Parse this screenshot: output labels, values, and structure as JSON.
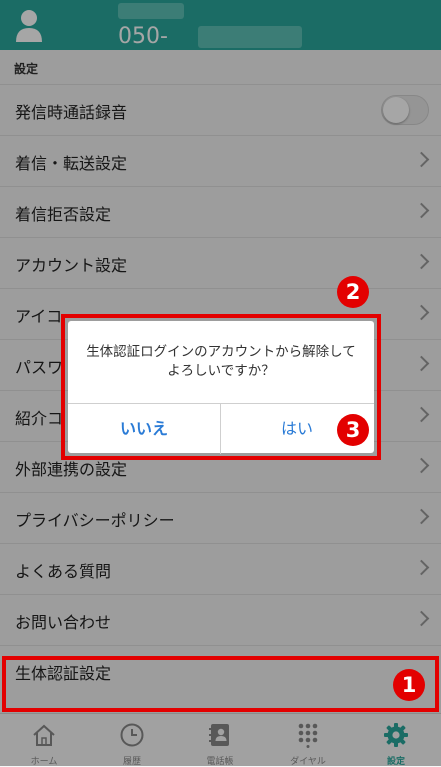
{
  "header": {
    "phone_prefix": "050-"
  },
  "section_title": "設定",
  "settings": {
    "items": [
      {
        "label": "発信時通話録音",
        "control": "toggle",
        "toggle_on": false
      },
      {
        "label": "着信・転送設定"
      },
      {
        "label": "着信拒否設定"
      },
      {
        "label": "アカウント設定"
      },
      {
        "label": "アイコ"
      },
      {
        "label": "パスワ"
      },
      {
        "label": "紹介コ"
      },
      {
        "label": "外部連携の設定"
      },
      {
        "label": "プライバシーポリシー"
      },
      {
        "label": "よくある質問"
      },
      {
        "label": "お問い合わせ"
      },
      {
        "label": "生体認証設定"
      }
    ]
  },
  "dialog": {
    "message": "生体認証ログインのアカウントから解除してよろしいですか？",
    "cancel_label": "いいえ",
    "confirm_label": "はい"
  },
  "tabs": [
    {
      "label": "ホーム",
      "icon": "home-icon"
    },
    {
      "label": "履歴",
      "icon": "clock-icon"
    },
    {
      "label": "電話帳",
      "icon": "contacts-icon"
    },
    {
      "label": "ダイヤル",
      "icon": "dialpad-icon"
    },
    {
      "label": "設定",
      "icon": "gear-icon",
      "active": true
    }
  ],
  "annotations": {
    "badge1": "1",
    "badge2": "2",
    "badge3": "3"
  },
  "colors": {
    "brand": "#2aa79b",
    "highlight": "#e30000",
    "dialog_button": "#2a7bd6"
  }
}
